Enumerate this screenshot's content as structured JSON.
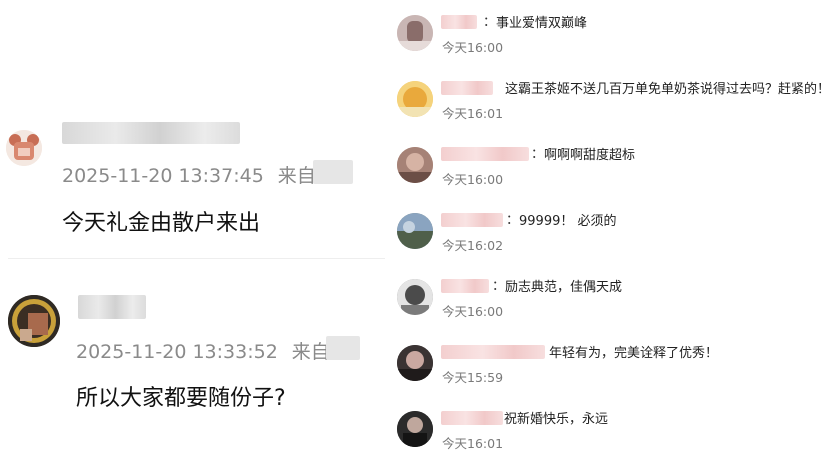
{
  "left_comments": [
    {
      "timestamp": "2025-11-20 13:37:45",
      "source_label": "来自",
      "text": "今天礼金由散户来出"
    },
    {
      "timestamp": "2025-11-20 13:33:52",
      "source_label": "来自",
      "text": "所以大家都要随份子?"
    }
  ],
  "right_comments": [
    {
      "colon": "：",
      "text": "事业爱情双巅峰",
      "time": "今天16:00"
    },
    {
      "colon": "：",
      "text": "这霸王茶姬不送几百万单免单奶茶说得过去吗？赶紧的！",
      "time": "今天16:01"
    },
    {
      "colon": "：",
      "text": "啊啊啊甜度超标",
      "time": "今天16:00"
    },
    {
      "colon": "：",
      "text": "99999！ 必须的",
      "time": "今天16:02"
    },
    {
      "colon": "：",
      "text": "励志典范，佳偶天成",
      "time": "今天16:00"
    },
    {
      "colon": "",
      "text": "年轻有为，完美诠释了优秀！",
      "time": "今天15:59"
    },
    {
      "colon": "",
      "text": "祝新婚快乐，永远",
      "time": "今天16:01"
    }
  ],
  "colors": {
    "meta_gray": "#8a8a8a",
    "time_gray": "#7a7a7a",
    "text": "#111111",
    "blur_pink": "#f3d2d2"
  }
}
